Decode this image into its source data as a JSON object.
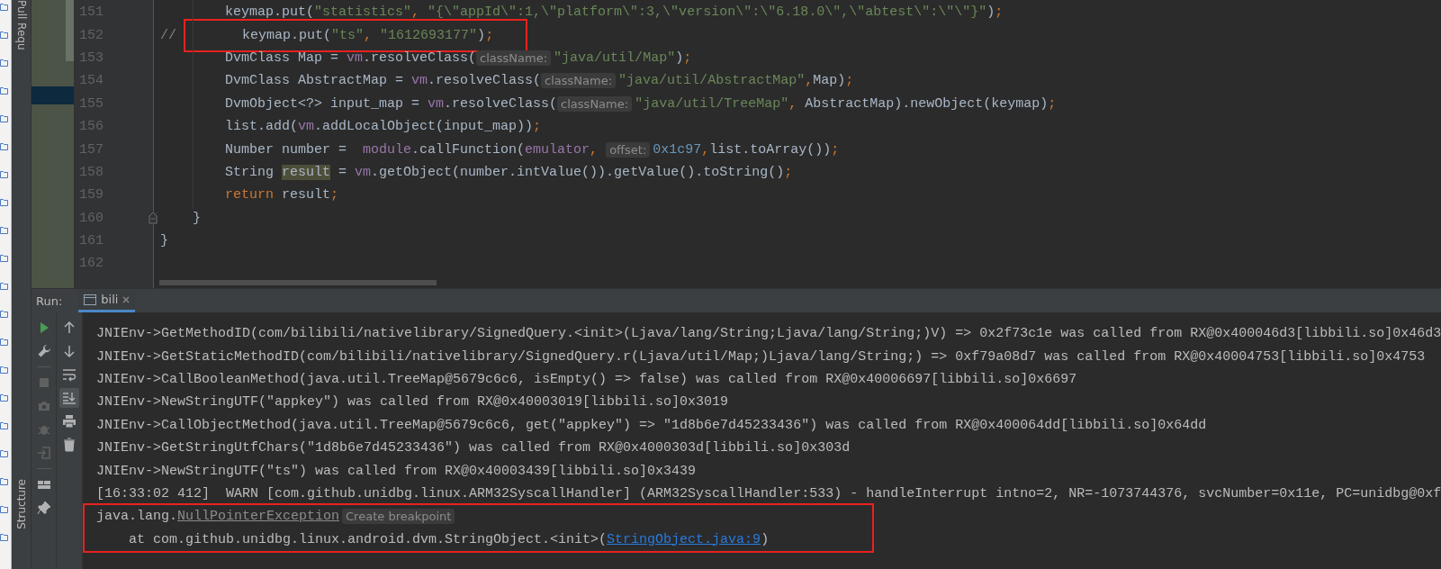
{
  "side_bar": {
    "top_tab": "Pull Requ",
    "bottom_tab": "Structure"
  },
  "editor": {
    "lines": [
      {
        "number": "151",
        "tokens": [
          {
            "kind": "plain",
            "text": "        keymap.put("
          },
          {
            "kind": "string",
            "text": "\"statistics\""
          },
          {
            "kind": "punct",
            "text": ", "
          },
          {
            "kind": "string",
            "text": "\"{\\\"appId\\\":1,\\\"platform\\\":3,\\\"version\\\":\\\"6.18.0\\\",\\\"abtest\\\":\\\"\\\"}\""
          },
          {
            "kind": "plain",
            "text": ")"
          },
          {
            "kind": "punct",
            "text": ";"
          }
        ]
      },
      {
        "number": "152",
        "tokens": [
          {
            "kind": "comment",
            "text": "//"
          }
        ],
        "framed": [
          {
            "kind": "plain",
            "text": "       keymap.put("
          },
          {
            "kind": "string",
            "text": "\"ts\""
          },
          {
            "kind": "punct",
            "text": ", "
          },
          {
            "kind": "string",
            "text": "\"1612693177\""
          },
          {
            "kind": "plain",
            "text": ")"
          },
          {
            "kind": "punct",
            "text": ";"
          }
        ]
      },
      {
        "number": "153",
        "tokens": [
          {
            "kind": "plain",
            "text": "        DvmClass Map = "
          },
          {
            "kind": "field",
            "text": "vm"
          },
          {
            "kind": "plain",
            "text": ".resolveClass("
          },
          {
            "kind": "hint",
            "text": "className:"
          },
          {
            "kind": "string",
            "text": "\"java/util/Map\""
          },
          {
            "kind": "plain",
            "text": ")"
          },
          {
            "kind": "punct",
            "text": ";"
          }
        ]
      },
      {
        "number": "154",
        "tokens": [
          {
            "kind": "plain",
            "text": "        DvmClass AbstractMap = "
          },
          {
            "kind": "field",
            "text": "vm"
          },
          {
            "kind": "plain",
            "text": ".resolveClass("
          },
          {
            "kind": "hint",
            "text": "className:"
          },
          {
            "kind": "string",
            "text": "\"java/util/AbstractMap\""
          },
          {
            "kind": "punct",
            "text": ","
          },
          {
            "kind": "plain",
            "text": "Map)"
          },
          {
            "kind": "punct",
            "text": ";"
          }
        ]
      },
      {
        "number": "155",
        "tokens": [
          {
            "kind": "plain",
            "text": "        DvmObject<?> input_map = "
          },
          {
            "kind": "field",
            "text": "vm"
          },
          {
            "kind": "plain",
            "text": ".resolveClass("
          },
          {
            "kind": "hint",
            "text": "className:"
          },
          {
            "kind": "string",
            "text": "\"java/util/TreeMap\""
          },
          {
            "kind": "punct",
            "text": ", "
          },
          {
            "kind": "plain",
            "text": "AbstractMap).newObject(keymap)"
          },
          {
            "kind": "punct",
            "text": ";"
          }
        ]
      },
      {
        "number": "156",
        "tokens": [
          {
            "kind": "plain",
            "text": "        list.add("
          },
          {
            "kind": "field",
            "text": "vm"
          },
          {
            "kind": "plain",
            "text": ".addLocalObject(input_map))"
          },
          {
            "kind": "punct",
            "text": ";"
          }
        ]
      },
      {
        "number": "157",
        "tokens": [
          {
            "kind": "plain",
            "text": "        Number number =  "
          },
          {
            "kind": "field",
            "text": "module"
          },
          {
            "kind": "plain",
            "text": ".callFunction("
          },
          {
            "kind": "field",
            "text": "emulator"
          },
          {
            "kind": "punct",
            "text": ", "
          },
          {
            "kind": "hint",
            "text": "offset:"
          },
          {
            "kind": "number",
            "text": "0x1c97"
          },
          {
            "kind": "punct",
            "text": ","
          },
          {
            "kind": "plain",
            "text": "list.toArray())"
          },
          {
            "kind": "punct",
            "text": ";"
          }
        ]
      },
      {
        "number": "158",
        "tokens": [
          {
            "kind": "plain",
            "text": "        String "
          },
          {
            "kind": "highlight",
            "text": "result"
          },
          {
            "kind": "plain",
            "text": " = "
          },
          {
            "kind": "field",
            "text": "vm"
          },
          {
            "kind": "plain",
            "text": ".getObject(number.intValue()).getValue().toString()"
          },
          {
            "kind": "punct",
            "text": ";"
          }
        ]
      },
      {
        "number": "159",
        "tokens": [
          {
            "kind": "keyword",
            "text": "        return "
          },
          {
            "kind": "plain",
            "text": "result"
          },
          {
            "kind": "punct",
            "text": ";"
          }
        ]
      },
      {
        "number": "160",
        "fold": true,
        "tokens": [
          {
            "kind": "plain",
            "text": "    }"
          }
        ]
      },
      {
        "number": "161",
        "tokens": [
          {
            "kind": "plain",
            "text": "}"
          }
        ]
      },
      {
        "number": "162"
      }
    ]
  },
  "run_panel": {
    "label": "Run:",
    "tab": {
      "title": "bili",
      "selected": true
    },
    "tools_left": [
      {
        "kind": "run",
        "disabled": false
      },
      {
        "kind": "wrench",
        "disabled": false
      },
      {
        "kind": "stop",
        "disabled": true
      },
      {
        "kind": "camera",
        "disabled": true
      },
      {
        "kind": "bug",
        "disabled": true
      },
      {
        "kind": "exit",
        "disabled": true
      },
      {
        "kind": "layout",
        "disabled": false
      },
      {
        "kind": "pin",
        "disabled": false
      }
    ],
    "tools_right": [
      {
        "kind": "up",
        "selected": false
      },
      {
        "kind": "down",
        "selected": false
      },
      {
        "kind": "wrap",
        "selected": false
      },
      {
        "kind": "scroll-end",
        "selected": true
      },
      {
        "kind": "print",
        "selected": false
      },
      {
        "kind": "trash",
        "selected": false
      }
    ],
    "console": [
      {
        "tokens": [
          {
            "kind": "plain",
            "text": "JNIEnv->GetMethodID(com/bilibili/nativelibrary/SignedQuery.<init>(Ljava/lang/String;Ljava/lang/String;)V) => 0x2f73c1e was called from RX@0x400046d3[libbili.so]0x46d3"
          }
        ]
      },
      {
        "tokens": [
          {
            "kind": "plain",
            "text": "JNIEnv->GetStaticMethodID(com/bilibili/nativelibrary/SignedQuery.r(Ljava/util/Map;)Ljava/lang/String;) => 0xf79a08d7 was called from RX@0x40004753[libbili.so]0x4753"
          }
        ]
      },
      {
        "tokens": [
          {
            "kind": "plain",
            "text": "JNIEnv->CallBooleanMethod(java.util.TreeMap@5679c6c6, isEmpty() => false) was called from RX@0x40006697[libbili.so]0x6697"
          }
        ]
      },
      {
        "tokens": [
          {
            "kind": "plain",
            "text": "JNIEnv->NewStringUTF(\"appkey\") was called from RX@0x40003019[libbili.so]0x3019"
          }
        ]
      },
      {
        "tokens": [
          {
            "kind": "plain",
            "text": "JNIEnv->CallObjectMethod(java.util.TreeMap@5679c6c6, get(\"appkey\") => \"1d8b6e7d45233436\") was called from RX@0x400064dd[libbili.so]0x64dd"
          }
        ]
      },
      {
        "tokens": [
          {
            "kind": "plain",
            "text": "JNIEnv->GetStringUtfChars(\"1d8b6e7d45233436\") was called from RX@0x4000303d[libbili.so]0x303d"
          }
        ]
      },
      {
        "tokens": [
          {
            "kind": "plain",
            "text": "JNIEnv->NewStringUTF(\"ts\") was called from RX@0x40003439[libbili.so]0x3439"
          }
        ]
      },
      {
        "tokens": [
          {
            "kind": "plain",
            "text": "[16:33:02 412]  WARN [com.github.unidbg.linux.ARM32SyscallHandler] (ARM32SyscallHandler:533) - handleInterrupt intno=2, NR=-1073744376, svcNumber=0x11e, PC=unidbg@0xf"
          }
        ]
      },
      {
        "marked": true,
        "tokens": [
          {
            "kind": "plain",
            "text": "java.lang."
          },
          {
            "kind": "link",
            "text": "NullPointerException"
          },
          {
            "kind": "hint",
            "text": "Create breakpoint"
          }
        ]
      },
      {
        "marked": true,
        "tokens": [
          {
            "kind": "plain",
            "text": "    at com.github.unidbg.linux.android.dvm.StringObject.<init>("
          },
          {
            "kind": "url",
            "text": "StringObject.java:9"
          },
          {
            "kind": "plain",
            "text": ")"
          }
        ]
      }
    ]
  }
}
